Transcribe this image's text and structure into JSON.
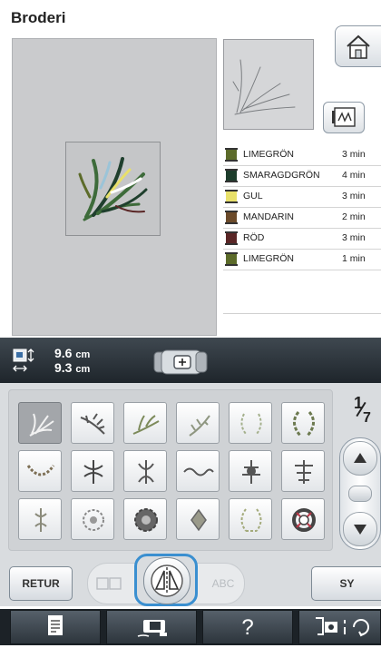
{
  "header": {
    "title": "Broderi"
  },
  "color_list": [
    {
      "name": "LIMEGRÖN",
      "time": "3 min",
      "color": "#5c6b2a"
    },
    {
      "name": "SMARAGDGRÖN",
      "time": "4 min",
      "color": "#1d3d2c"
    },
    {
      "name": "GUL",
      "time": "3 min",
      "color": "#e8e06a"
    },
    {
      "name": "MANDARIN",
      "time": "2 min",
      "color": "#6b4a2a"
    },
    {
      "name": "RÖD",
      "time": "3 min",
      "color": "#5a2626"
    },
    {
      "name": "LIMEGRÖN",
      "time": "1 min",
      "color": "#5c6b2a"
    }
  ],
  "size": {
    "height_value": "9.6",
    "width_value": "9.3",
    "unit": "cm"
  },
  "pagination": {
    "current": "1",
    "total": "7"
  },
  "buttons": {
    "retur": "RETUR",
    "sy": "SY",
    "abc": "ABC",
    "help": "?"
  },
  "icons": {
    "home": "home-icon",
    "stitch_view": "stitch-view-icon",
    "size": "size-icon",
    "frame": "embroidery-frame-icon",
    "array": "array-icon",
    "mirror": "mirror-icon",
    "settings": "settings-icon",
    "camera": "camera-icon",
    "machine": "machine-icon",
    "up": "chevron-up-icon",
    "down": "chevron-down-icon"
  },
  "colors": {
    "accent_highlight": "#3a8fd0",
    "dark_bar": "#1e252b",
    "panel_gray": "#cacbcd"
  }
}
